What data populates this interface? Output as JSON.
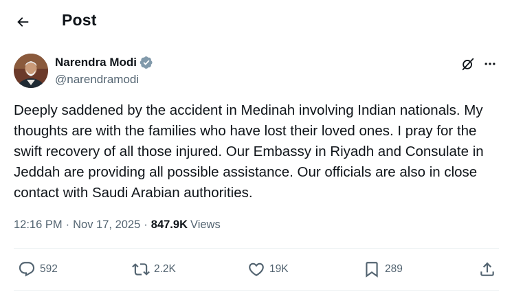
{
  "header": {
    "title": "Post",
    "back_icon": "arrow-left-icon"
  },
  "author": {
    "display_name": "Narendra Modi",
    "handle": "@narendramodi",
    "verified_icon": "verified-badge-icon",
    "verified_color": "#829aab",
    "grok_icon": "grok-icon",
    "more_icon": "more-horizontal-icon"
  },
  "post": {
    "text": "Deeply saddened by the accident in Medinah involving Indian nationals. My thoughts are with the families who have lost their loved ones. I pray for the swift recovery of all those injured. Our Embassy in Riyadh and Consulate in Jeddah are providing all possible assistance. Our officials are also in close contact with Saudi Arabian authorities.",
    "time": "12:16 PM",
    "separator": "·",
    "date": "Nov 17, 2025",
    "views_count": "847.9K",
    "views_label": "Views"
  },
  "actions": {
    "reply": {
      "icon": "reply-bubble-icon",
      "count": "592"
    },
    "repost": {
      "icon": "repost-icon",
      "count": "2.2K"
    },
    "like": {
      "icon": "heart-icon",
      "count": "19K"
    },
    "bookmark": {
      "icon": "bookmark-icon",
      "count": "289"
    },
    "share": {
      "icon": "share-icon"
    }
  },
  "colors": {
    "text_primary": "#0f1419",
    "text_secondary": "#536471",
    "divider": "#eff3f4"
  }
}
